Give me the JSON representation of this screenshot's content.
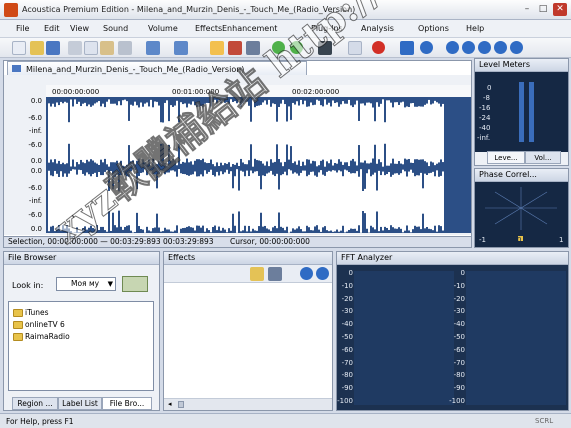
{
  "window": {
    "title": "Acoustica Premium Edition - Milena_and_Murzin_Denis_-_Touch_Me_(Radio_Version)",
    "minimize": "–",
    "maximize": "□",
    "close": "✕"
  },
  "menu": [
    "File",
    "Edit",
    "View",
    "Sound",
    "Volume",
    "Effects",
    "Enhancement",
    "Plug-Ins",
    "Analysis",
    "Options",
    "Help"
  ],
  "wave": {
    "tab_title": "Milena_and_Murzin_Denis_-_Touch_Me_(Radio_Version)",
    "time_marks": [
      "00:00:00:000",
      "00:01:00:000",
      "00:02:00:000"
    ],
    "db_scale": [
      "0.0",
      "-6.0",
      "-inf.",
      "-6.0",
      "0.0",
      "0.0",
      "-6.0",
      "-inf.",
      "-6.0",
      "0.0"
    ],
    "selection_text": "Selection, 00:00:00:000 — 00:03:29:893  00:03:29:893",
    "cursor_text": "Cursor, 00:00:00:000"
  },
  "level_meter": {
    "title": "Level Meters",
    "scale": [
      "0",
      "-8",
      "-16",
      "-24",
      "-40",
      "-inf."
    ],
    "tabs": [
      "Leve...",
      "Vol..."
    ]
  },
  "phase": {
    "title": "Phase Correl...",
    "left": "-1",
    "center": "0",
    "right": "1"
  },
  "file_browser": {
    "title": "File Browser",
    "look_in_label": "Look in:",
    "look_in_value": "Моя му",
    "items": [
      "iTunes",
      "onlineTV 6",
      "RaimaRadio"
    ],
    "tabs": [
      "Region ...",
      "Label List",
      "File Bro..."
    ]
  },
  "effects": {
    "title": "Effects"
  },
  "fft": {
    "title": "FFT Analyzer",
    "scale": [
      "0",
      "-10",
      "-20",
      "-30",
      "-40",
      "-50",
      "-60",
      "-70",
      "-80",
      "-90",
      "-100"
    ]
  },
  "status": {
    "text": "For Help, press F1",
    "scrl": "SCRL"
  },
  "watermark": "xyz軟體補給站 http://31.to",
  "colors": {
    "wave_fill": "#ffffff",
    "wave_bg": "#2c4f86",
    "meter_bg": "#152844"
  }
}
